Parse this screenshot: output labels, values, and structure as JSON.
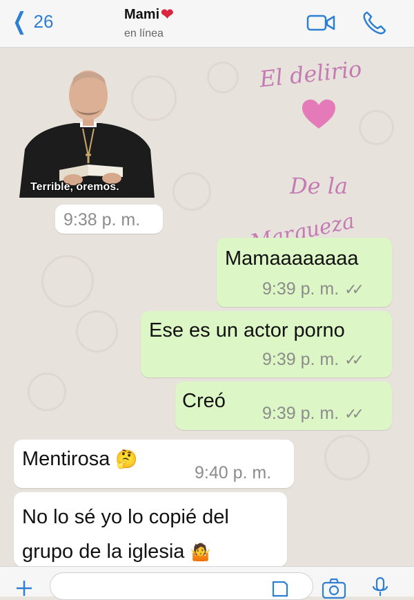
{
  "header": {
    "back_count": "26",
    "contact_name": "Mami",
    "contact_emoji": "❤",
    "status": "en línea",
    "icons": [
      "chevron-left-icon",
      "video-camera-icon",
      "phone-icon"
    ]
  },
  "sticker": {
    "caption": "Terrible, oremos.",
    "time": "9:38 p. m."
  },
  "watermark": {
    "line1": "El delirio",
    "line2": "De la",
    "line3": "Marqueza"
  },
  "messages": [
    {
      "text": "Mamaaaaaaaa",
      "time": "9:39 p. m.",
      "direction": "out"
    },
    {
      "text": "Ese es un actor porno",
      "time": "9:39 p. m.",
      "direction": "out"
    },
    {
      "text": "Creó",
      "time": "9:39 p. m.",
      "direction": "out"
    },
    {
      "text": "Mentirosa",
      "emoji": "🤔",
      "time": "9:40 p. m.",
      "direction": "in"
    },
    {
      "text_line1": "No lo sé yo lo copié del",
      "text_line2": "grupo de la iglesia",
      "emoji": "🤷",
      "direction": "in"
    }
  ],
  "read_ticks": "✓✓",
  "colors": {
    "accent": "#2d7fd3",
    "outgoing": "#dcf7c5",
    "incoming": "#ffffff",
    "background": "#e7e2db",
    "watermark": "#c47bb3"
  }
}
